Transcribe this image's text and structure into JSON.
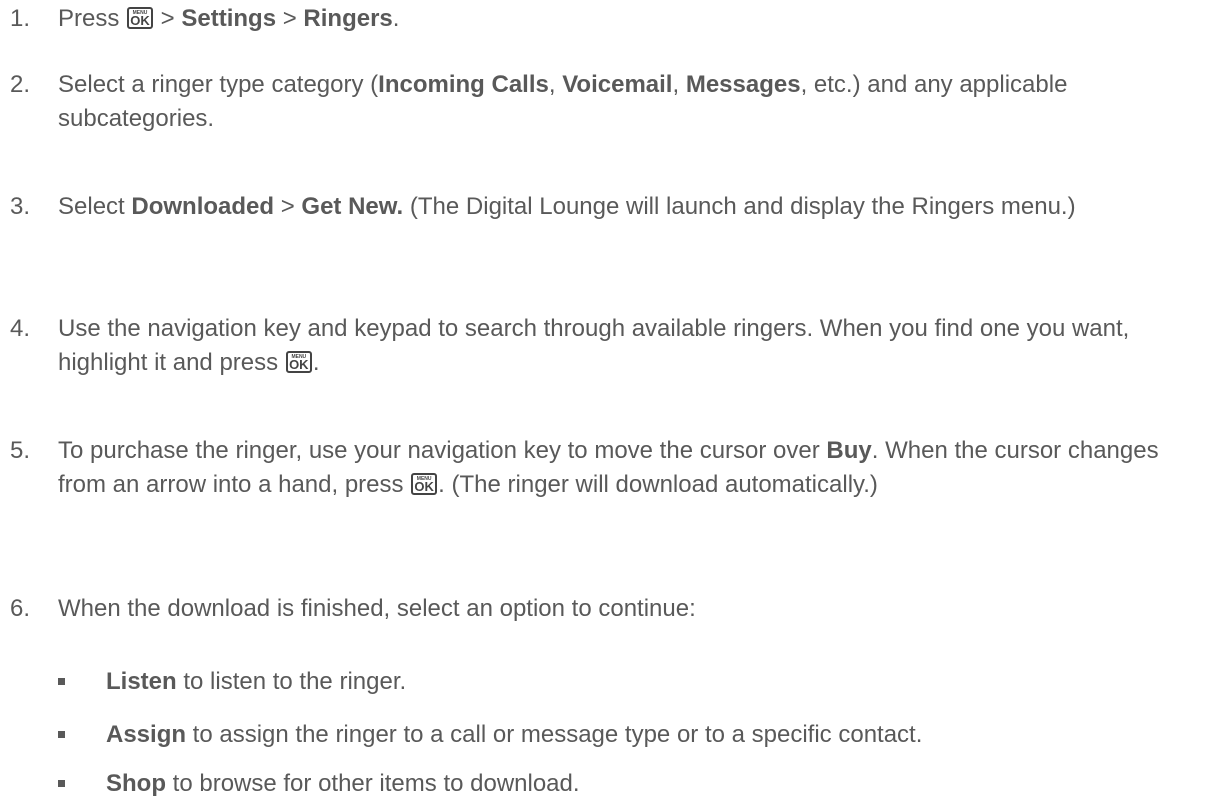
{
  "steps": [
    {
      "num": "1.",
      "parts": [
        {
          "t": "Press "
        },
        {
          "key": true
        },
        {
          "t": " > "
        },
        {
          "b": "Settings"
        },
        {
          "t": " > "
        },
        {
          "b": "Ringers"
        },
        {
          "t": "."
        }
      ]
    },
    {
      "num": "2.",
      "parts": [
        {
          "t": "Select a ringer type category ("
        },
        {
          "b": "Incoming Calls"
        },
        {
          "t": ", "
        },
        {
          "b": "Voicemail"
        },
        {
          "t": ", "
        },
        {
          "b": "Messages"
        },
        {
          "t": ", etc.) and any applicable subcategories."
        }
      ]
    },
    {
      "num": "3.",
      "parts": [
        {
          "t": "Select "
        },
        {
          "b": "Downloaded"
        },
        {
          "t": " > "
        },
        {
          "b": "Get New."
        },
        {
          "t": " (The Digital Lounge will launch and display the Ringers menu.)"
        }
      ]
    },
    {
      "num": "4.",
      "parts": [
        {
          "t": "Use the navigation key and keypad to search through available ringers. When you find one you want, highlight it and press "
        },
        {
          "key": true
        },
        {
          "t": "."
        }
      ]
    },
    {
      "num": "5.",
      "parts": [
        {
          "t": "To purchase the ringer, use your navigation key to move the cursor over "
        },
        {
          "b": "Buy"
        },
        {
          "t": ". When the cursor changes from an arrow into a hand, press "
        },
        {
          "key": true
        },
        {
          "t": ". (The ringer will download automatically.)"
        }
      ]
    },
    {
      "num": "6.",
      "parts": [
        {
          "t": "When the download is finished, select an option to continue:"
        }
      ]
    }
  ],
  "options": [
    {
      "label": "Listen",
      "text": " to listen to the ringer."
    },
    {
      "label": "Assign",
      "text": " to assign the ringer to a call or message type or to a specific contact."
    },
    {
      "label": "Shop",
      "text": " to browse for other items to download."
    }
  ],
  "key_icon": {
    "top": "MENU",
    "bottom": "OK"
  }
}
